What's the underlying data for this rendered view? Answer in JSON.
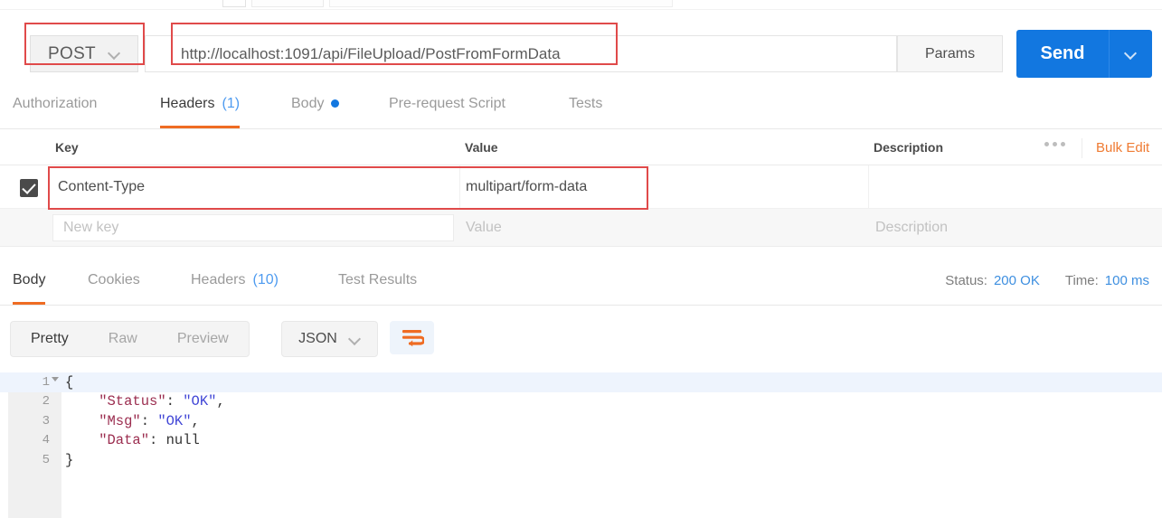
{
  "request_bar": {
    "method": "POST",
    "method_icon": "chevron-down-icon",
    "url": "http://localhost:1091/api/FileUpload/PostFromFormData",
    "params_label": "Params",
    "send_label": "Send",
    "send_caret_icon": "chevron-down-icon",
    "accent_blue": "#1277e0",
    "annotation_color": "#e04a4a"
  },
  "request_tabs": [
    {
      "label": "Authorization",
      "count": "",
      "active": false,
      "dot": false
    },
    {
      "label": "Headers",
      "count": "(1)",
      "active": true,
      "dot": false
    },
    {
      "label": "Body",
      "count": "",
      "active": false,
      "dot": true
    },
    {
      "label": "Pre-request Script",
      "count": "",
      "active": false,
      "dot": false
    },
    {
      "label": "Tests",
      "count": "",
      "active": false,
      "dot": false
    }
  ],
  "headers_table": {
    "columns": [
      "Key",
      "Value",
      "Description"
    ],
    "menu_icon": "ellipsis-icon",
    "bulk_edit_label": "Bulk Edit",
    "bulk_edit_color": "#ef7b33",
    "rows": [
      {
        "checked": true,
        "key": "Content-Type",
        "value": "multipart/form-data",
        "description": ""
      }
    ],
    "new_row": {
      "key_placeholder": "New key",
      "value_placeholder": "Value",
      "description_placeholder": "Description"
    }
  },
  "response_tabs": [
    {
      "label": "Body",
      "count": "",
      "active": true
    },
    {
      "label": "Cookies",
      "count": "",
      "active": false
    },
    {
      "label": "Headers",
      "count": "(10)",
      "active": false
    },
    {
      "label": "Test Results",
      "count": "",
      "active": false
    }
  ],
  "response_meta": {
    "status_label": "Status:",
    "status_value": "200 OK",
    "time_label": "Time:",
    "time_value": "100 ms",
    "value_color": "#3e8fe0"
  },
  "body_toolbar": {
    "view_modes": [
      "Pretty",
      "Raw",
      "Preview"
    ],
    "active_mode": "Pretty",
    "format": "JSON",
    "format_icon": "chevron-down-icon",
    "wrap_icon": "word-wrap-icon",
    "wrap_icon_color": "#ef6c23"
  },
  "response_body": {
    "language": "json",
    "lines": [
      {
        "num": "1",
        "foldable": true,
        "highlight": true,
        "tokens": [
          {
            "t": "{",
            "c": "p"
          }
        ]
      },
      {
        "num": "2",
        "foldable": false,
        "highlight": false,
        "tokens": [
          {
            "t": "    \"Status\"",
            "c": "k"
          },
          {
            "t": ": ",
            "c": "p"
          },
          {
            "t": "\"OK\"",
            "c": "s"
          },
          {
            "t": ",",
            "c": "p"
          }
        ]
      },
      {
        "num": "3",
        "foldable": false,
        "highlight": false,
        "tokens": [
          {
            "t": "    \"Msg\"",
            "c": "k"
          },
          {
            "t": ": ",
            "c": "p"
          },
          {
            "t": "\"OK\"",
            "c": "s"
          },
          {
            "t": ",",
            "c": "p"
          }
        ]
      },
      {
        "num": "4",
        "foldable": false,
        "highlight": false,
        "tokens": [
          {
            "t": "    \"Data\"",
            "c": "k"
          },
          {
            "t": ": ",
            "c": "p"
          },
          {
            "t": "null",
            "c": "n"
          }
        ]
      },
      {
        "num": "5",
        "foldable": false,
        "highlight": false,
        "tokens": [
          {
            "t": "}",
            "c": "p"
          }
        ]
      }
    ]
  }
}
